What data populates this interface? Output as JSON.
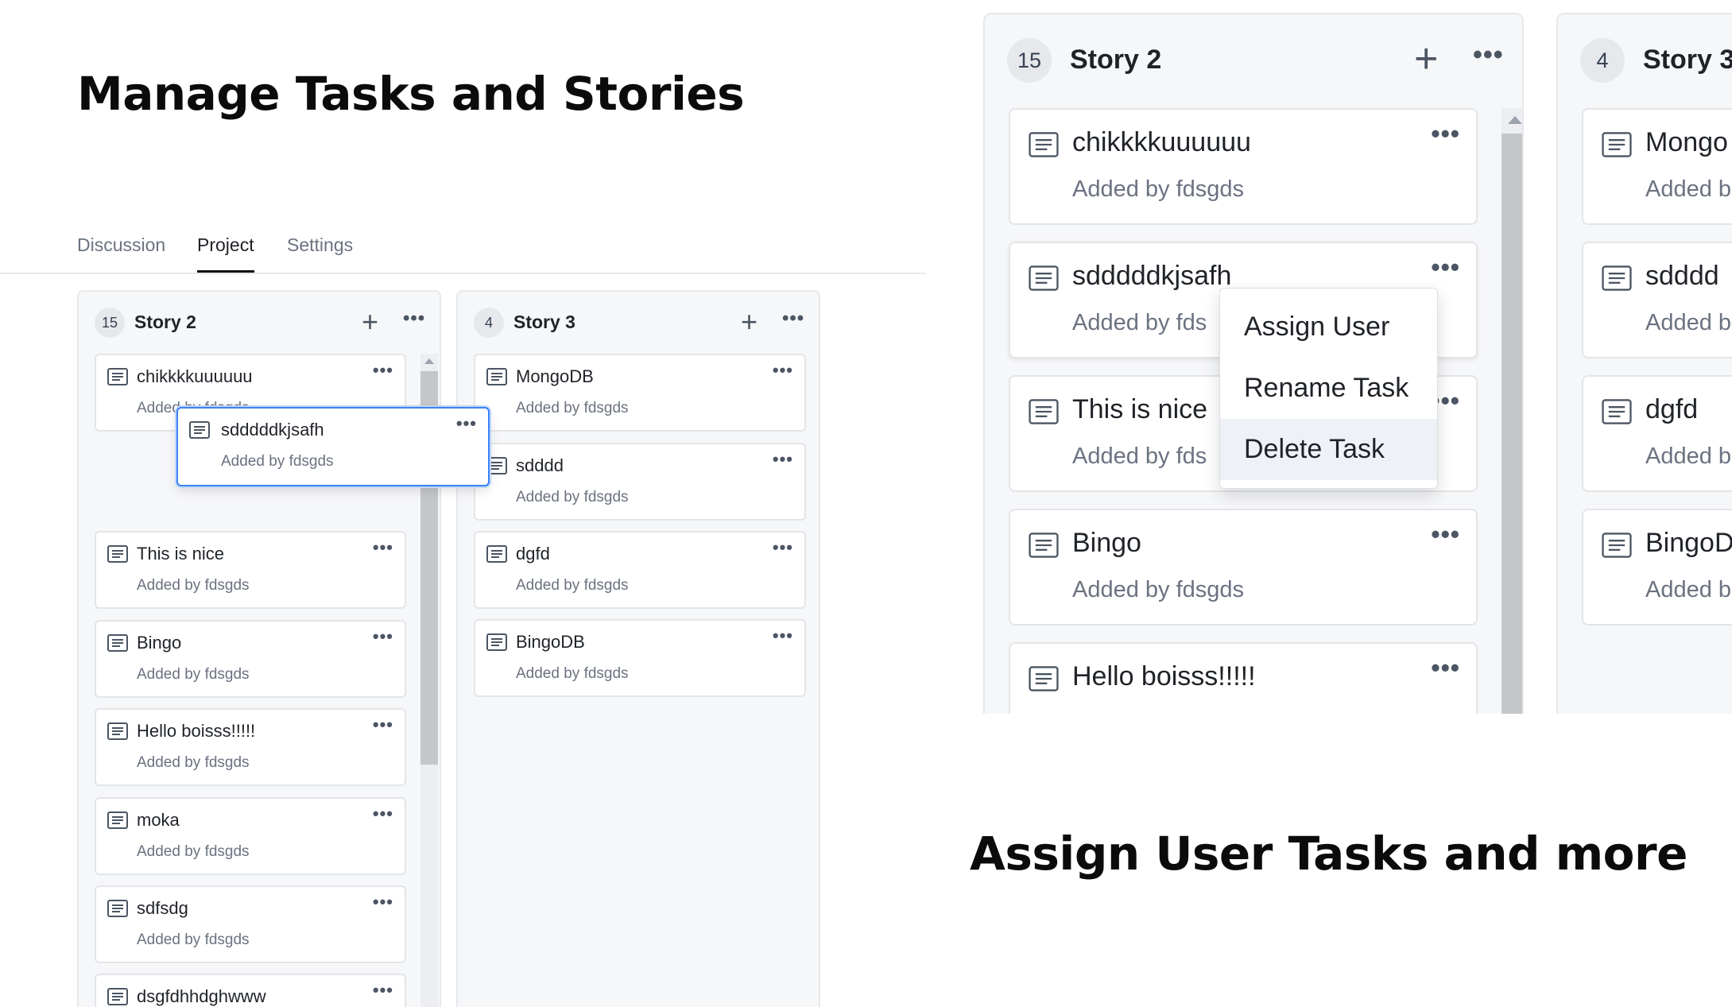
{
  "headings": {
    "left": "Manage Tasks and Stories",
    "right": "Assign User Tasks and more"
  },
  "tabs": [
    {
      "label": "Discussion",
      "active": false
    },
    {
      "label": "Project",
      "active": true
    },
    {
      "label": "Settings",
      "active": false
    }
  ],
  "columns": [
    {
      "count": "15",
      "title": "Story 2",
      "tasks": [
        {
          "title": "chikkkkuuuuuu",
          "sub": "Added by fdsgds"
        },
        {
          "title": "This is nice",
          "sub": "Added by fdsgds"
        },
        {
          "title": "Bingo",
          "sub": "Added by fdsgds"
        },
        {
          "title": "Hello boisss!!!!!",
          "sub": "Added by fdsgds"
        },
        {
          "title": "moka",
          "sub": "Added by fdsgds"
        },
        {
          "title": "sdfsdg",
          "sub": "Added by fdsgds"
        },
        {
          "title": "dsgfdhhdghwww",
          "sub": ""
        }
      ]
    },
    {
      "count": "4",
      "title": "Story 3",
      "tasks": [
        {
          "title": "MongoDB",
          "sub": "Added by fdsgds"
        },
        {
          "title": "sdddd",
          "sub": "Added by fdsgds"
        },
        {
          "title": "dgfd",
          "sub": "Added by fdsgds"
        },
        {
          "title": "BingoDB",
          "sub": "Added by fdsgds"
        }
      ]
    }
  ],
  "dragged_task": {
    "title": "sdddddkjsafh",
    "sub": "Added by fdsgds"
  },
  "zoom": {
    "col1": {
      "count": "15",
      "title": "Story 2",
      "tasks": [
        {
          "title": "chikkkkuuuuuu",
          "sub": "Added by fdsgds"
        },
        {
          "title": "sdddddkjsafh",
          "sub": "Added by fds"
        },
        {
          "title": "This is nice",
          "sub": "Added by fds"
        },
        {
          "title": "Bingo",
          "sub": "Added by fdsgds"
        },
        {
          "title": "Hello boisss!!!!!",
          "sub": ""
        }
      ]
    },
    "col2": {
      "count": "4",
      "title": "Story 3",
      "tasks": [
        {
          "title": "Mongo",
          "sub": "Added b"
        },
        {
          "title": "sdddd",
          "sub": "Added b"
        },
        {
          "title": "dgfd",
          "sub": "Added b"
        },
        {
          "title": "BingoD",
          "sub": "Added b"
        }
      ]
    },
    "menu": [
      "Assign User",
      "Rename Task",
      "Delete Task"
    ],
    "menu_hover_index": 2
  },
  "icons": {
    "task": "document-lines-icon",
    "add": "plus-icon",
    "more": "ellipsis-icon"
  },
  "colors": {
    "drag_border": "#3b82f6",
    "column_bg": "#f6f7f9",
    "card_border": "#e3e5e8"
  }
}
